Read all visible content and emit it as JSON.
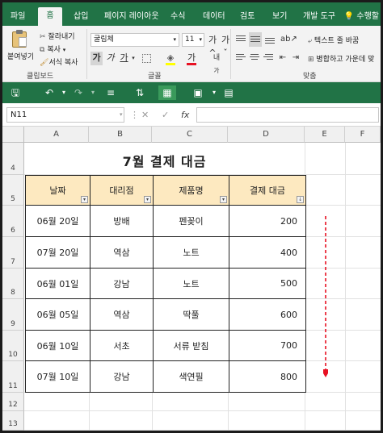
{
  "ribbon_tabs": [
    {
      "label": "파일",
      "active": false
    },
    {
      "label": "홈",
      "active": true
    },
    {
      "label": "삽입",
      "active": false
    },
    {
      "label": "페이지 레이아웃",
      "active": false
    },
    {
      "label": "수식",
      "active": false
    },
    {
      "label": "데이터",
      "active": false
    },
    {
      "label": "검토",
      "active": false
    },
    {
      "label": "보기",
      "active": false
    },
    {
      "label": "개발 도구",
      "active": false
    }
  ],
  "tell_me": "수행할",
  "clipboard": {
    "cut": "잘라내기",
    "copy": "복사",
    "paste": "붙여넣기",
    "format_painter": "서식 복사",
    "group_label": "클립보드"
  },
  "font": {
    "name": "굴림체",
    "size": "11",
    "group_label": "글꼴",
    "grow_icon": "가^",
    "shrink_icon": "가ˇ",
    "bold": "가",
    "italic": "가",
    "underline": "가",
    "font_color": "가",
    "font_color_accent": "#e81123",
    "fill_accent": "#ffff00"
  },
  "alignment": {
    "wrap_text": "텍스트 줄 바꿈",
    "merge_center": "병합하고 가운데 맞",
    "group_label": "맞춤"
  },
  "formula_bar": {
    "name_box": "N11",
    "formula": ""
  },
  "columns": [
    "A",
    "B",
    "C",
    "D",
    "E",
    "F"
  ],
  "rows": [
    "4",
    "5",
    "6",
    "7",
    "8",
    "9",
    "10",
    "11",
    "12",
    "13"
  ],
  "sheet": {
    "title": "7월 결제 대금",
    "headers": [
      "날짜",
      "대리점",
      "제품명",
      "결제 대금"
    ],
    "data": [
      [
        "06월 20일",
        "방배",
        "펜꽂이",
        "200"
      ],
      [
        "07월 20일",
        "역삼",
        "노트",
        "400"
      ],
      [
        "06월 01일",
        "강남",
        "노트",
        "500"
      ],
      [
        "06월 05일",
        "역삼",
        "딱풀",
        "600"
      ],
      [
        "06월 10일",
        "서초",
        "서류 받침",
        "700"
      ],
      [
        "07월 10일",
        "강남",
        "색연필",
        "800"
      ]
    ]
  },
  "colors": {
    "excel_green": "#217346",
    "header_fill": "#fde9c0",
    "arrow": "#e81123"
  }
}
